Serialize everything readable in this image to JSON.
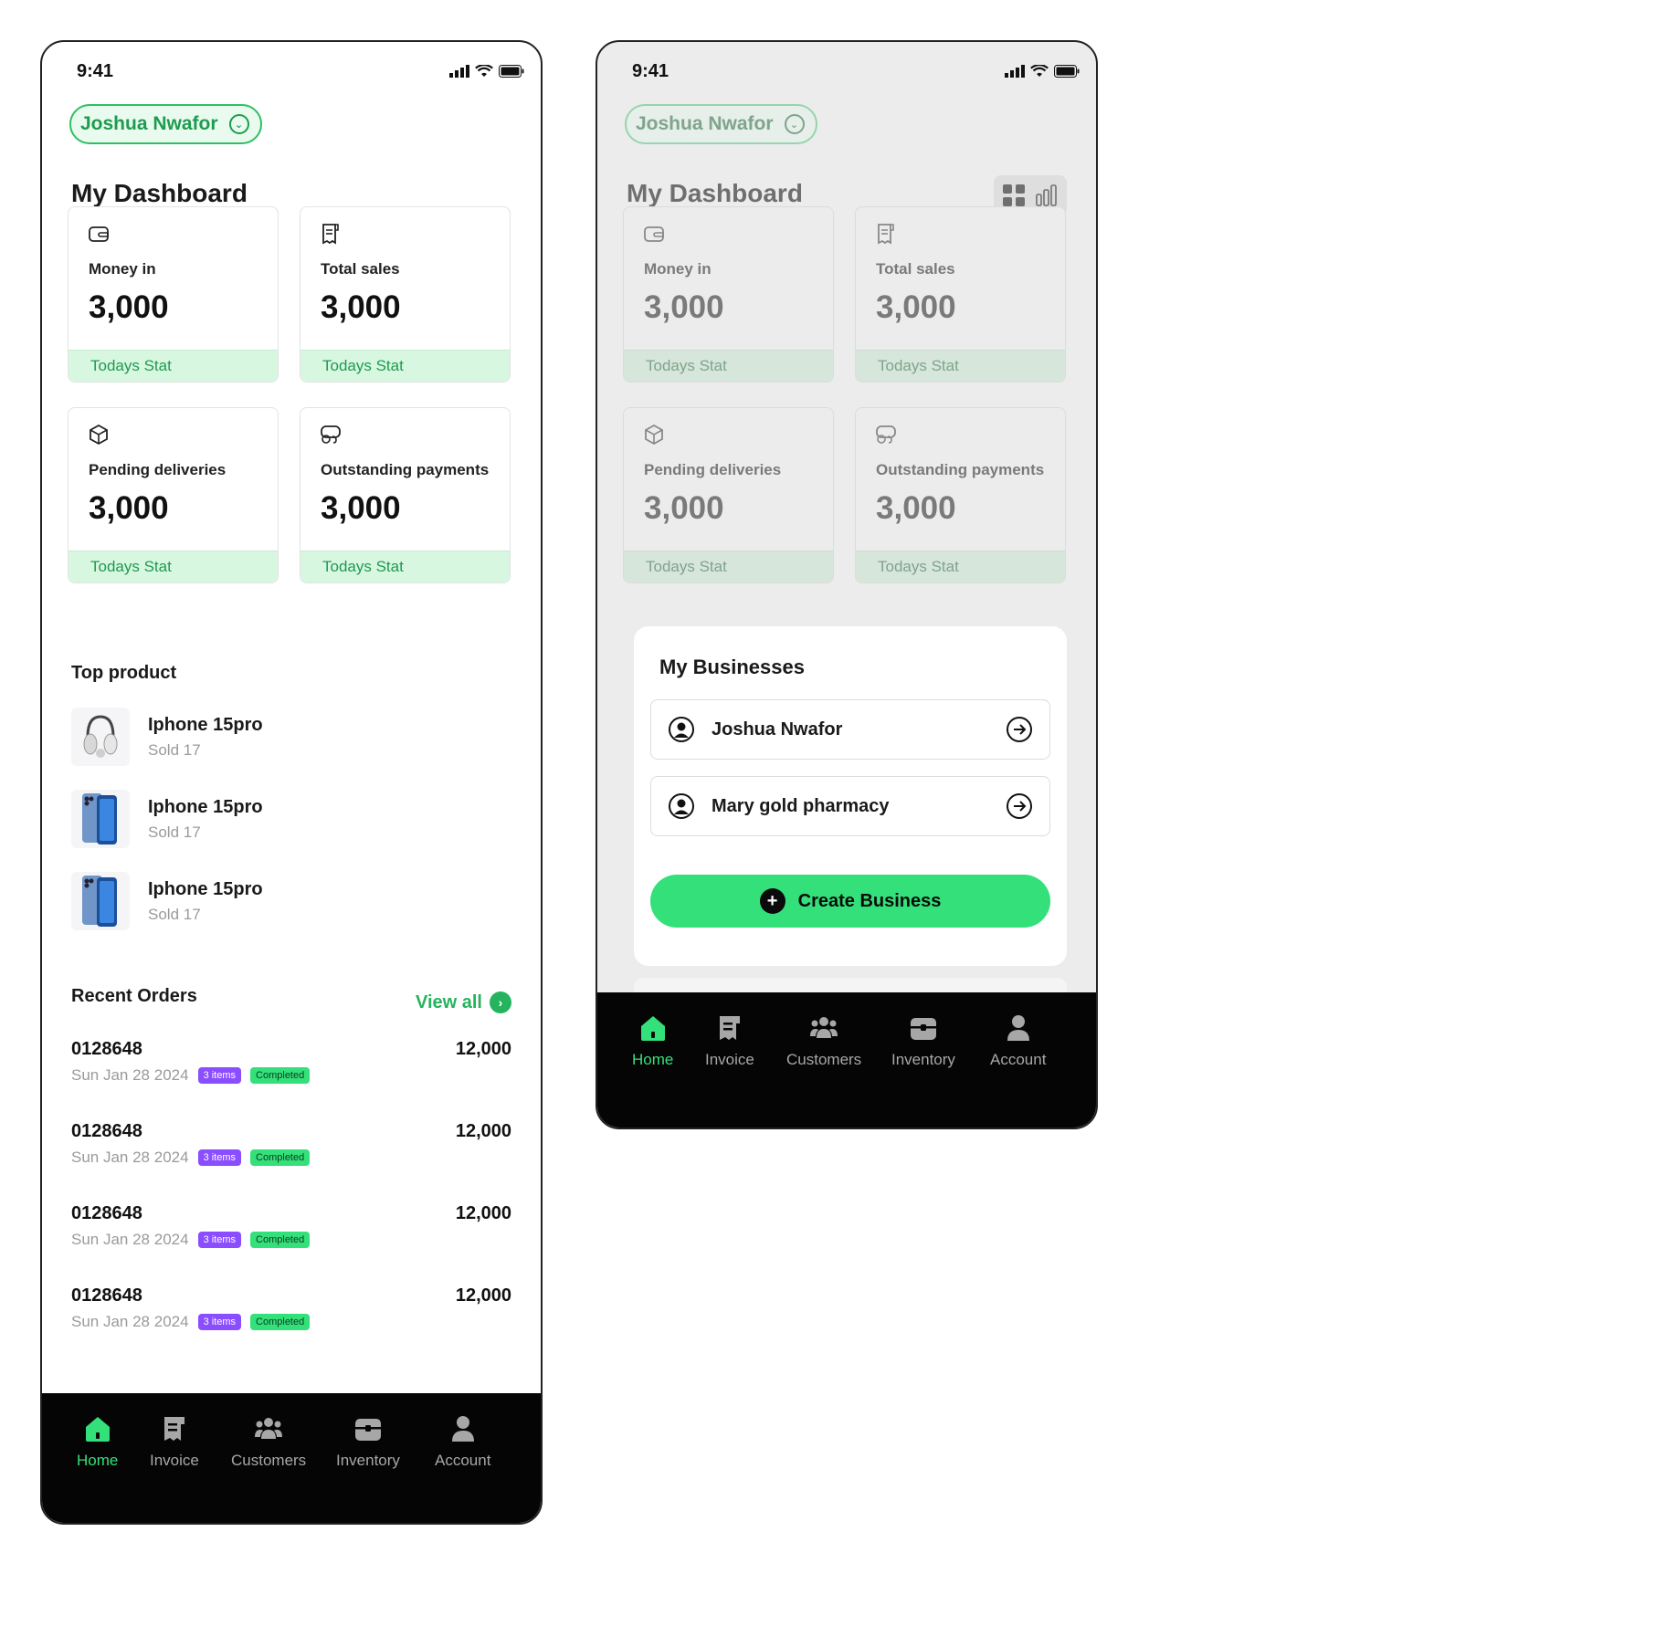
{
  "status_bar": {
    "time": "9:41"
  },
  "user": {
    "name": "Joshua Nwafor"
  },
  "dashboard": {
    "title": "My Dashboard",
    "cards": [
      {
        "label": "Money in",
        "value": "3,000",
        "footer": "Todays Stat",
        "icon": "wallet-icon"
      },
      {
        "label": "Total sales",
        "value": "3,000",
        "footer": "Todays Stat",
        "icon": "receipt-icon"
      },
      {
        "label": "Pending deliveries",
        "value": "3,000",
        "footer": "Todays Stat",
        "icon": "box-icon"
      },
      {
        "label": "Outstanding payments",
        "value": "3,000",
        "footer": "Todays Stat",
        "icon": "coins-icon"
      }
    ]
  },
  "top_product": {
    "title": "Top product",
    "items": [
      {
        "name": "Iphone 15pro",
        "sold": "Sold 17",
        "image": "headphones-image"
      },
      {
        "name": "Iphone 15pro",
        "sold": "Sold 17",
        "image": "phone-image"
      },
      {
        "name": "Iphone 15pro",
        "sold": "Sold 17",
        "image": "phone-image"
      }
    ]
  },
  "recent_orders": {
    "title": "Recent Orders",
    "view_all": "View all",
    "items": [
      {
        "id": "0128648",
        "date": "Sun Jan 28 2024",
        "items_badge": "3 items",
        "status": "Completed",
        "amount": "12,000"
      },
      {
        "id": "0128648",
        "date": "Sun Jan 28 2024",
        "items_badge": "3 items",
        "status": "Completed",
        "amount": "12,000"
      },
      {
        "id": "0128648",
        "date": "Sun Jan 28 2024",
        "items_badge": "3 items",
        "status": "Completed",
        "amount": "12,000"
      },
      {
        "id": "0128648",
        "date": "Sun Jan 28 2024",
        "items_badge": "3 items",
        "status": "Completed",
        "amount": "12,000"
      }
    ]
  },
  "businesses": {
    "title": "My Businesses",
    "items": [
      {
        "name": "Joshua Nwafor"
      },
      {
        "name": "Mary gold pharmacy"
      }
    ],
    "create_label": "Create Business"
  },
  "tabbar": {
    "items": [
      {
        "label": "Home",
        "icon": "home-icon",
        "active": true
      },
      {
        "label": "Invoice",
        "icon": "invoice-icon",
        "active": false
      },
      {
        "label": "Customers",
        "icon": "customers-icon",
        "active": false
      },
      {
        "label": "Inventory",
        "icon": "inventory-icon",
        "active": false
      },
      {
        "label": "Account",
        "icon": "account-icon",
        "active": false
      }
    ]
  },
  "colors": {
    "accent": "#33e07a",
    "accent_dark": "#1f9b4f",
    "stat_bg": "#d8f7e1",
    "badge_purple": "#8a4dff",
    "tabbar_bg": "#050505"
  }
}
